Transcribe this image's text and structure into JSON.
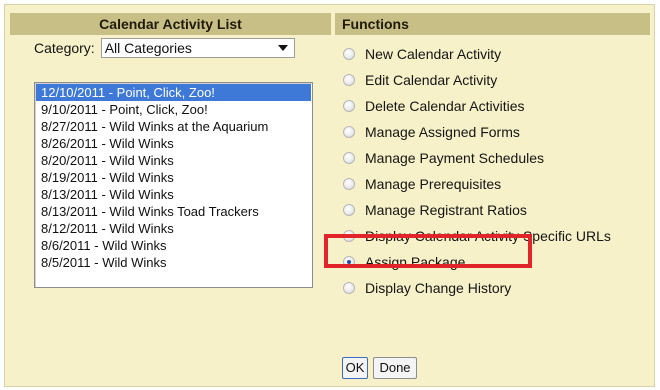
{
  "left_panel": {
    "header": "Calendar Activity List",
    "category_label": "Category:",
    "category_value": "All Categories",
    "activities": [
      "12/10/2011 - Point, Click, Zoo!",
      "9/10/2011 - Point, Click, Zoo!",
      "8/27/2011 - Wild Winks at the Aquarium",
      "8/26/2011 - Wild Winks",
      "8/20/2011 - Wild Winks",
      "8/19/2011 - Wild Winks",
      "8/13/2011 - Wild Winks",
      "8/13/2011 - Wild Winks Toad Trackers",
      "8/12/2011 - Wild Winks",
      "8/6/2011 - Wild Winks",
      "8/5/2011 - Wild Winks"
    ],
    "selected_index": 0
  },
  "right_panel": {
    "header": "Functions",
    "functions": [
      "New Calendar Activity",
      "Edit Calendar Activity",
      "Delete Calendar Activities",
      "Manage Assigned Forms",
      "Manage Payment Schedules",
      "Manage Prerequisites",
      "Manage Registrant Ratios",
      "Display Calendar Activity Specific URLs",
      "Assign Package",
      "Display Change History"
    ],
    "selected_index": 8
  },
  "buttons": {
    "ok": "OK",
    "done": "Done"
  },
  "colors": {
    "panel_bg": "#f6f1c8",
    "header_bg": "#c8bf86",
    "selection": "#3e79d8",
    "highlight": "#e0242a"
  }
}
